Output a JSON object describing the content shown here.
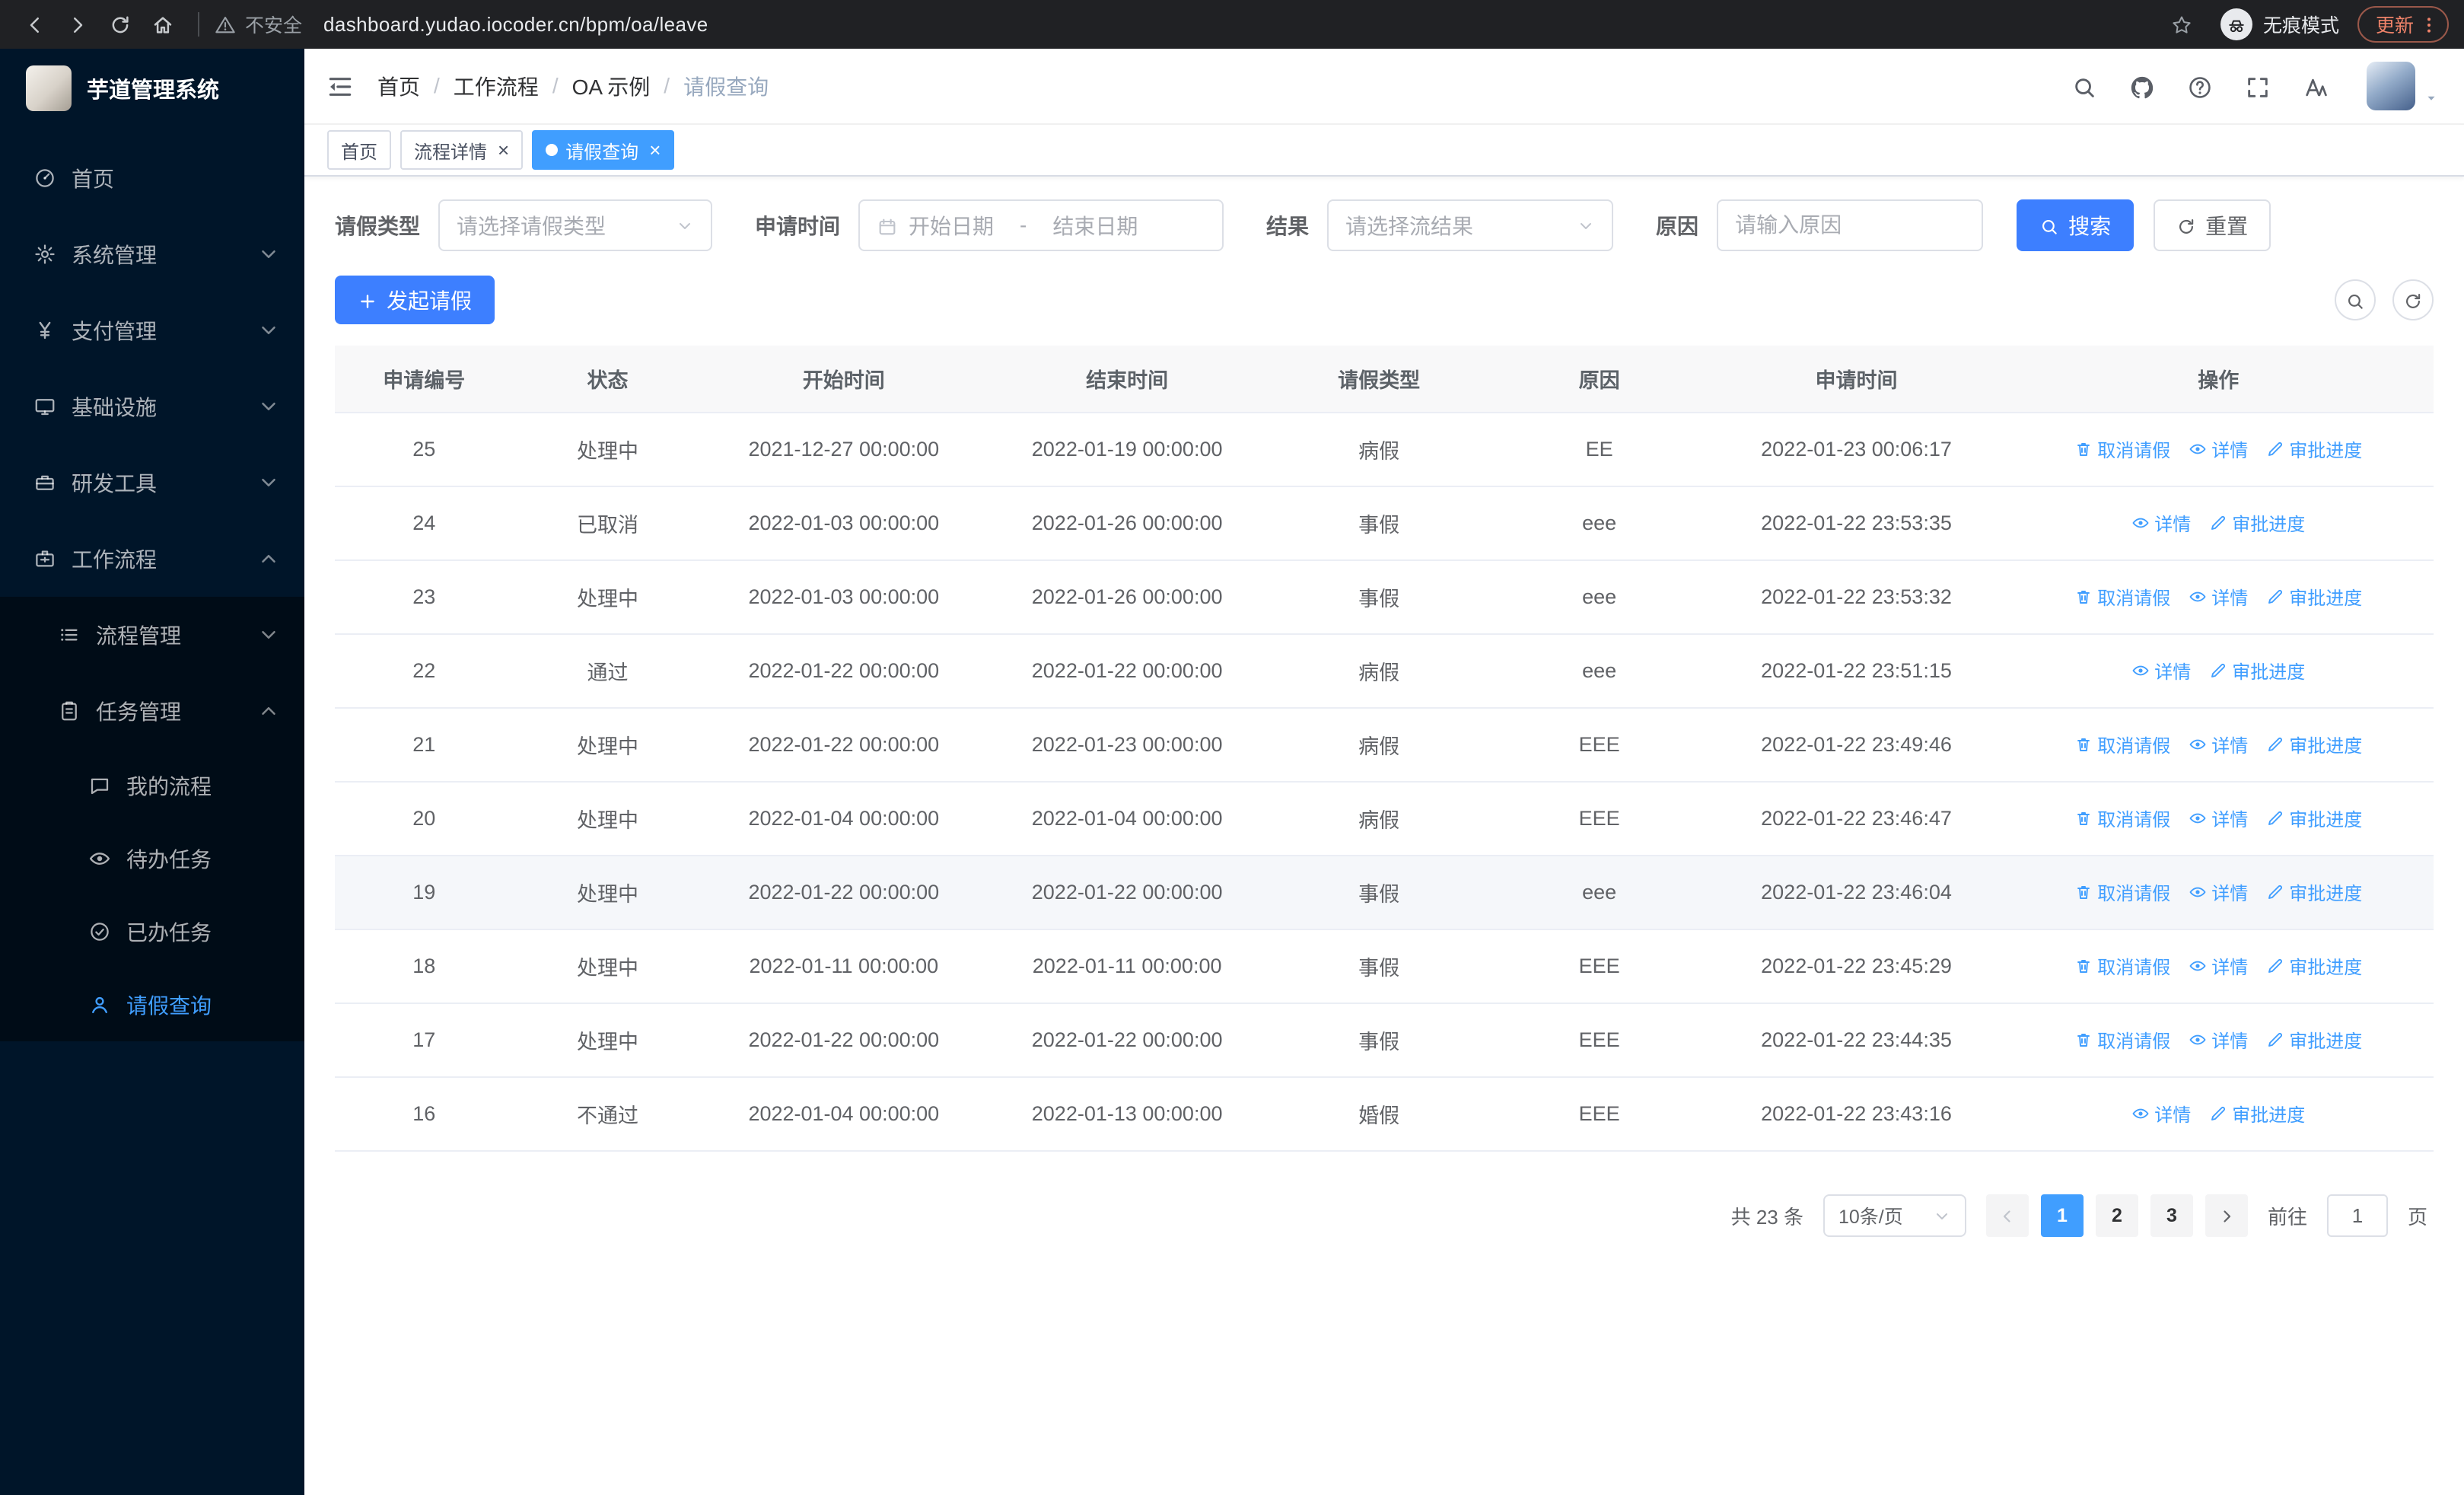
{
  "colors": {
    "primary": "#409eff",
    "button_blue": "#3d7fff",
    "sidebar_bg": "#001529",
    "sidebar_submenu_bg": "#000c17",
    "chrome_bg": "#202124"
  },
  "browser": {
    "security_label": "不安全",
    "url": "dashboard.yudao.iocoder.cn/bpm/oa/leave",
    "incognito_label": "无痕模式",
    "update_label": "更新"
  },
  "sidebar": {
    "logo_title": "芋道管理系统",
    "items": [
      {
        "name": "home",
        "label": "首页",
        "icon": "dashboard-icon",
        "level": 1
      },
      {
        "name": "system-management",
        "label": "系统管理",
        "icon": "gear-icon",
        "level": 1,
        "chevron": "down"
      },
      {
        "name": "payment-management",
        "label": "支付管理",
        "icon": "yen-icon",
        "level": 1,
        "chevron": "down"
      },
      {
        "name": "infrastructure",
        "label": "基础设施",
        "icon": "monitor-icon",
        "level": 1,
        "chevron": "down"
      },
      {
        "name": "dev-tools",
        "label": "研发工具",
        "icon": "toolbox-icon",
        "level": 1,
        "chevron": "down"
      },
      {
        "name": "workflow",
        "label": "工作流程",
        "icon": "briefcase-icon",
        "level": 1,
        "chevron": "up"
      },
      {
        "name": "process-management",
        "label": "流程管理",
        "icon": "list-icon",
        "level": 2,
        "chevron": "down",
        "sub": true
      },
      {
        "name": "task-management",
        "label": "任务管理",
        "icon": "clipboard-icon",
        "level": 2,
        "chevron": "up",
        "sub": true
      },
      {
        "name": "my-process",
        "label": "我的流程",
        "icon": "chat-icon",
        "level": 3,
        "sub": true
      },
      {
        "name": "todo-tasks",
        "label": "待办任务",
        "icon": "eye-icon",
        "level": 3,
        "sub": true
      },
      {
        "name": "done-tasks",
        "label": "已办任务",
        "icon": "check-circle-icon",
        "level": 3,
        "sub": true
      },
      {
        "name": "leave-query",
        "label": "请假查询",
        "icon": "user-icon",
        "level": 3,
        "sub": true,
        "active": true
      }
    ]
  },
  "topbar": {
    "breadcrumb": [
      {
        "label": "首页"
      },
      {
        "label": "工作流程"
      },
      {
        "label": "OA 示例"
      },
      {
        "label": "请假查询"
      }
    ]
  },
  "tabs": [
    {
      "name": "home",
      "label": "首页",
      "closable": false,
      "active": false
    },
    {
      "name": "process-detail",
      "label": "流程详情",
      "closable": true,
      "active": false
    },
    {
      "name": "leave-query",
      "label": "请假查询",
      "closable": true,
      "active": true
    }
  ],
  "filters": {
    "leave_type_label": "请假类型",
    "leave_type_placeholder": "请选择请假类型",
    "apply_time_label": "申请时间",
    "start_placeholder": "开始日期",
    "range_separator": "-",
    "end_placeholder": "结束日期",
    "result_label": "结果",
    "result_placeholder": "请选择流结果",
    "reason_label": "原因",
    "reason_placeholder": "请输入原因",
    "search_label": "搜索",
    "reset_label": "重置"
  },
  "toolbar": {
    "create_label": "发起请假"
  },
  "table": {
    "columns": [
      "申请编号",
      "状态",
      "开始时间",
      "结束时间",
      "请假类型",
      "原因",
      "申请时间",
      "操作"
    ],
    "action_defs": {
      "cancel": {
        "label": "取消请假",
        "icon": "delete-icon"
      },
      "detail": {
        "label": "详情",
        "icon": "eye-icon"
      },
      "progress": {
        "label": "审批进度",
        "icon": "edit-icon"
      }
    },
    "rows": [
      {
        "id": "25",
        "status": "处理中",
        "start": "2021-12-27 00:00:00",
        "end": "2022-01-19 00:00:00",
        "type": "病假",
        "reason": "EE",
        "applied": "2022-01-23 00:06:17",
        "actions": [
          "cancel",
          "detail",
          "progress"
        ]
      },
      {
        "id": "24",
        "status": "已取消",
        "start": "2022-01-03 00:00:00",
        "end": "2022-01-26 00:00:00",
        "type": "事假",
        "reason": "eee",
        "applied": "2022-01-22 23:53:35",
        "actions": [
          "detail",
          "progress"
        ]
      },
      {
        "id": "23",
        "status": "处理中",
        "start": "2022-01-03 00:00:00",
        "end": "2022-01-26 00:00:00",
        "type": "事假",
        "reason": "eee",
        "applied": "2022-01-22 23:53:32",
        "actions": [
          "cancel",
          "detail",
          "progress"
        ]
      },
      {
        "id": "22",
        "status": "通过",
        "start": "2022-01-22 00:00:00",
        "end": "2022-01-22 00:00:00",
        "type": "病假",
        "reason": "eee",
        "applied": "2022-01-22 23:51:15",
        "actions": [
          "detail",
          "progress"
        ]
      },
      {
        "id": "21",
        "status": "处理中",
        "start": "2022-01-22 00:00:00",
        "end": "2022-01-23 00:00:00",
        "type": "病假",
        "reason": "EEE",
        "applied": "2022-01-22 23:49:46",
        "actions": [
          "cancel",
          "detail",
          "progress"
        ]
      },
      {
        "id": "20",
        "status": "处理中",
        "start": "2022-01-04 00:00:00",
        "end": "2022-01-04 00:00:00",
        "type": "病假",
        "reason": "EEE",
        "applied": "2022-01-22 23:46:47",
        "actions": [
          "cancel",
          "detail",
          "progress"
        ]
      },
      {
        "id": "19",
        "status": "处理中",
        "start": "2022-01-22 00:00:00",
        "end": "2022-01-22 00:00:00",
        "type": "事假",
        "reason": "eee",
        "applied": "2022-01-22 23:46:04",
        "actions": [
          "cancel",
          "detail",
          "progress"
        ],
        "highlighted": true
      },
      {
        "id": "18",
        "status": "处理中",
        "start": "2022-01-11 00:00:00",
        "end": "2022-01-11 00:00:00",
        "type": "事假",
        "reason": "EEE",
        "applied": "2022-01-22 23:45:29",
        "actions": [
          "cancel",
          "detail",
          "progress"
        ]
      },
      {
        "id": "17",
        "status": "处理中",
        "start": "2022-01-22 00:00:00",
        "end": "2022-01-22 00:00:00",
        "type": "事假",
        "reason": "EEE",
        "applied": "2022-01-22 23:44:35",
        "actions": [
          "cancel",
          "detail",
          "progress"
        ]
      },
      {
        "id": "16",
        "status": "不通过",
        "start": "2022-01-04 00:00:00",
        "end": "2022-01-13 00:00:00",
        "type": "婚假",
        "reason": "EEE",
        "applied": "2022-01-22 23:43:16",
        "actions": [
          "detail",
          "progress"
        ]
      }
    ]
  },
  "pagination": {
    "total_text": "共 23 条",
    "page_size_value": "10条/页",
    "pages": [
      "1",
      "2",
      "3"
    ],
    "active_page": "1",
    "goto_label": "前往",
    "goto_value": "1",
    "goto_suffix": "页"
  }
}
